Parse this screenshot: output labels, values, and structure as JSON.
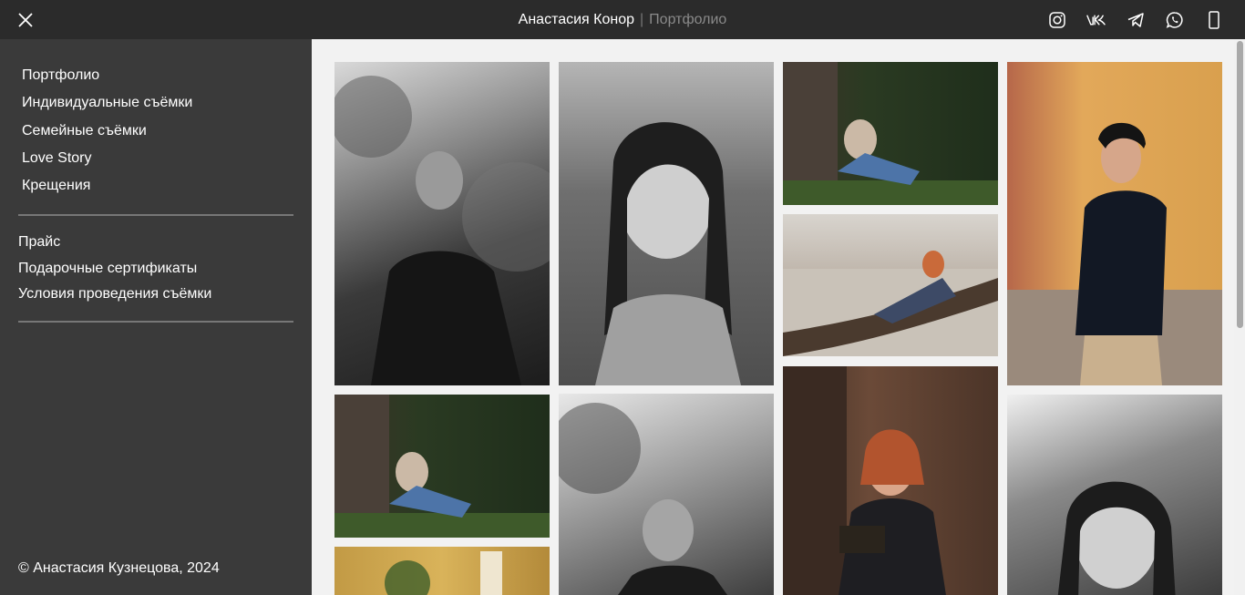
{
  "header": {
    "name": "Анастасия Конор",
    "separator": "|",
    "section": "Портфолио",
    "socials": [
      "instagram-icon",
      "vk-icon",
      "telegram-icon",
      "whatsapp-icon",
      "phone-icon"
    ]
  },
  "sidebar": {
    "menu_primary": [
      "Портфолио",
      "Индивидуальные съёмки",
      "Семейные съёмки",
      "Love Story",
      "Крещения"
    ],
    "menu_secondary": [
      "Прайс",
      "Подарочные сертификаты",
      "Условия проведения съёмки"
    ],
    "copyright": "© Анастасия Кузнецова, 2024"
  },
  "gallery": {
    "photos": [
      "young man smoking, black and white",
      "young woman with long hair, black and white",
      "woman reading book under tree",
      "young man in black hoodie by yellow wall",
      "woman lying on wooden bench in park",
      "woman reading book under tree",
      "young man smoking, black and white",
      "red-haired woman with glasses holding book",
      "young woman with hand at face, black and white",
      "young man by yellow building"
    ]
  },
  "colors": {
    "topbar": "#2b2b2b",
    "sidebar": "#3a3a3a",
    "content": "#f2f2f2"
  }
}
